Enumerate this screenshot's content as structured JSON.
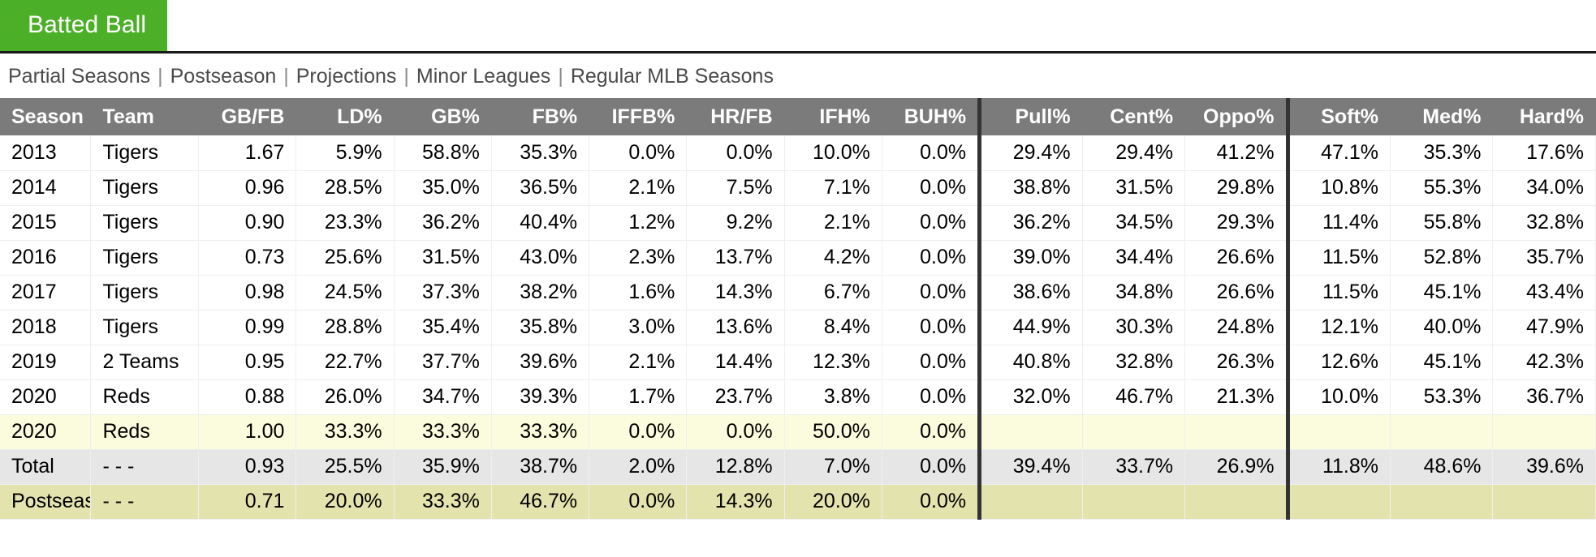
{
  "tab": {
    "label": "Batted Ball"
  },
  "subnav": {
    "items": [
      "Partial Seasons",
      "Postseason",
      "Projections",
      "Minor Leagues",
      "Regular MLB Seasons"
    ],
    "separator": "|"
  },
  "table": {
    "headers": [
      "Season",
      "Team",
      "GB/FB",
      "LD%",
      "GB%",
      "FB%",
      "IFFB%",
      "HR/FB",
      "IFH%",
      "BUH%",
      "Pull%",
      "Cent%",
      "Oppo%",
      "Soft%",
      "Med%",
      "Hard%"
    ],
    "rows": [
      {
        "style": "default",
        "cells": [
          "2013",
          "Tigers",
          "1.67",
          "5.9%",
          "58.8%",
          "35.3%",
          "0.0%",
          "0.0%",
          "10.0%",
          "0.0%",
          "29.4%",
          "29.4%",
          "41.2%",
          "47.1%",
          "35.3%",
          "17.6%"
        ]
      },
      {
        "style": "default",
        "cells": [
          "2014",
          "Tigers",
          "0.96",
          "28.5%",
          "35.0%",
          "36.5%",
          "2.1%",
          "7.5%",
          "7.1%",
          "0.0%",
          "38.8%",
          "31.5%",
          "29.8%",
          "10.8%",
          "55.3%",
          "34.0%"
        ]
      },
      {
        "style": "default",
        "cells": [
          "2015",
          "Tigers",
          "0.90",
          "23.3%",
          "36.2%",
          "40.4%",
          "1.2%",
          "9.2%",
          "2.1%",
          "0.0%",
          "36.2%",
          "34.5%",
          "29.3%",
          "11.4%",
          "55.8%",
          "32.8%"
        ]
      },
      {
        "style": "default",
        "cells": [
          "2016",
          "Tigers",
          "0.73",
          "25.6%",
          "31.5%",
          "43.0%",
          "2.3%",
          "13.7%",
          "4.2%",
          "0.0%",
          "39.0%",
          "34.4%",
          "26.6%",
          "11.5%",
          "52.8%",
          "35.7%"
        ]
      },
      {
        "style": "default",
        "cells": [
          "2017",
          "Tigers",
          "0.98",
          "24.5%",
          "37.3%",
          "38.2%",
          "1.6%",
          "14.3%",
          "6.7%",
          "0.0%",
          "38.6%",
          "34.8%",
          "26.6%",
          "11.5%",
          "45.1%",
          "43.4%"
        ]
      },
      {
        "style": "default",
        "cells": [
          "2018",
          "Tigers",
          "0.99",
          "28.8%",
          "35.4%",
          "35.8%",
          "3.0%",
          "13.6%",
          "8.4%",
          "0.0%",
          "44.9%",
          "30.3%",
          "24.8%",
          "12.1%",
          "40.0%",
          "47.9%"
        ]
      },
      {
        "style": "default",
        "cells": [
          "2019",
          "2 Teams",
          "0.95",
          "22.7%",
          "37.7%",
          "39.6%",
          "2.1%",
          "14.4%",
          "12.3%",
          "0.0%",
          "40.8%",
          "32.8%",
          "26.3%",
          "12.6%",
          "45.1%",
          "42.3%"
        ]
      },
      {
        "style": "default",
        "cells": [
          "2020",
          "Reds",
          "0.88",
          "26.0%",
          "34.7%",
          "39.3%",
          "1.7%",
          "23.7%",
          "3.8%",
          "0.0%",
          "32.0%",
          "46.7%",
          "21.3%",
          "10.0%",
          "53.3%",
          "36.7%"
        ]
      },
      {
        "style": "highlight",
        "cells": [
          "2020",
          "Reds",
          "1.00",
          "33.3%",
          "33.3%",
          "33.3%",
          "0.0%",
          "0.0%",
          "50.0%",
          "0.0%",
          "",
          "",
          "",
          "",
          "",
          ""
        ]
      },
      {
        "style": "total",
        "cells": [
          "Total",
          "- - -",
          "0.93",
          "25.5%",
          "35.9%",
          "38.7%",
          "2.0%",
          "12.8%",
          "7.0%",
          "0.0%",
          "39.4%",
          "33.7%",
          "26.9%",
          "11.8%",
          "48.6%",
          "39.6%"
        ]
      },
      {
        "style": "postseason",
        "cells": [
          "Postseason",
          "- - -",
          "0.71",
          "20.0%",
          "33.3%",
          "46.7%",
          "0.0%",
          "14.3%",
          "20.0%",
          "0.0%",
          "",
          "",
          "",
          "",
          "",
          ""
        ]
      }
    ]
  },
  "colors": {
    "tab_green": "#4caf28",
    "header_gray": "#7b7b7b",
    "highlight_yellow": "#fbfbdd",
    "total_gray": "#e6e6e6",
    "postseason_yellow": "#e3e3ae",
    "divider_black": "#333333"
  }
}
